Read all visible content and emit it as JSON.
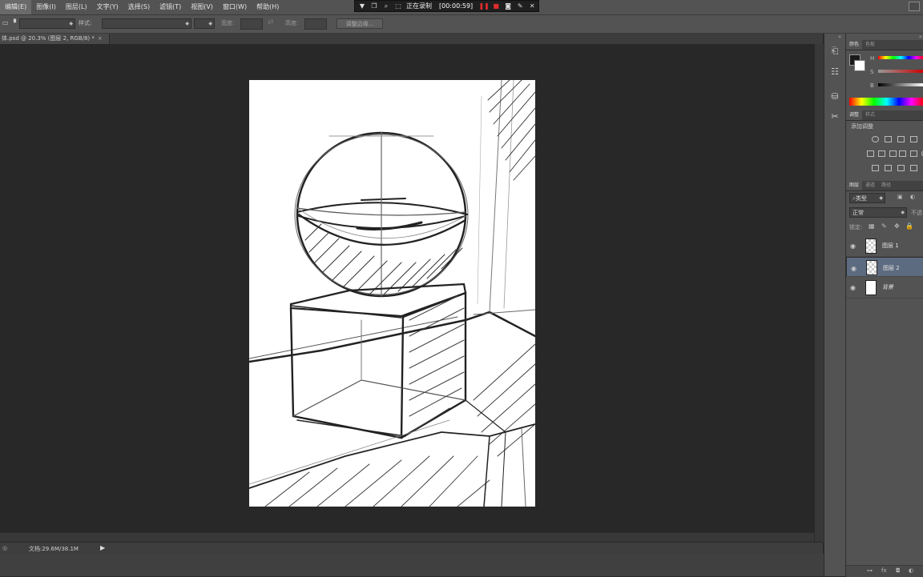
{
  "menu": [
    "编辑(E)",
    "图像(I)",
    "图层(L)",
    "文字(Y)",
    "选择(S)",
    "滤镜(T)",
    "视图(V)",
    "窗口(W)",
    "帮助(H)"
  ],
  "recorder": {
    "label": "正在录制",
    "timer": "[00:00:59]"
  },
  "options": {
    "style_label": "样式:",
    "width_label": "宽度:",
    "height_label": "高度:",
    "refine_label": "调整边缘..."
  },
  "document": {
    "tab_title": "体.psd @ 20.3% (图层 2, RGB/8) *",
    "status": "文档:29.6M/38.1M"
  },
  "color_panel": {
    "tabs": [
      "颜色",
      "色板"
    ],
    "h": "H",
    "s": "S",
    "b": "B"
  },
  "adjustments_panel": {
    "tabs": [
      "调整",
      "样式"
    ],
    "title": "添加调整"
  },
  "layers_panel": {
    "tabs": [
      "图层",
      "通道",
      "路径"
    ],
    "filter_kind": "类型",
    "blend_mode": "正常",
    "opacity_label": "不透",
    "lock_label": "锁定:",
    "layers": [
      {
        "name": "图层 1",
        "selected": false,
        "thumb": "transparent"
      },
      {
        "name": "图层 2",
        "selected": true,
        "thumb": "transparent"
      },
      {
        "name": "背景",
        "selected": false,
        "thumb": "white"
      }
    ]
  },
  "colors": {
    "accent": "#5d6b80",
    "ui_bg": "#535353",
    "canvas_bg": "#282828"
  }
}
